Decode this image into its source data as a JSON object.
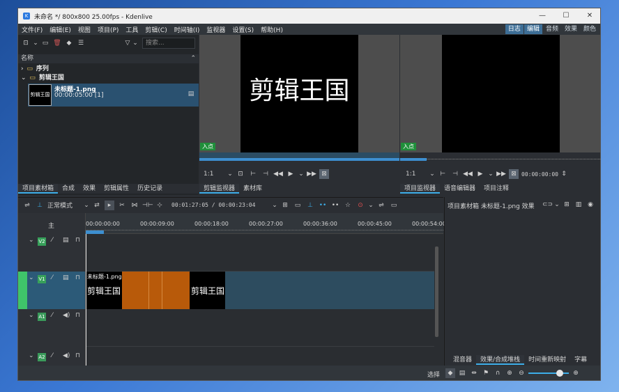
{
  "window": {
    "title": "未命名 */ 800x800 25.00fps - Kdenlive",
    "controls": [
      "—",
      "☐",
      "✕"
    ]
  },
  "menu": [
    "文件(F)",
    "编辑(E)",
    "视图",
    "项目(P)",
    "工具",
    "剪辑(C)",
    "时间轴(I)",
    "监视器",
    "设置(S)",
    "帮助(H)"
  ],
  "layouts": [
    "日志",
    "编辑",
    "音频",
    "效果",
    "颜色"
  ],
  "bin": {
    "search_placeholder": "搜索...",
    "header": "名称",
    "folders": [
      "序列",
      "剪辑王国"
    ],
    "clip": {
      "name": "未标题-1.png",
      "duration": "00:00:05:00 [1]",
      "thumb_text": "剪辑王国"
    }
  },
  "left_tabs": [
    "项目素材箱",
    "合成",
    "效果",
    "剪辑属性",
    "历史记录"
  ],
  "clip_monitor": {
    "text": "剪辑王国",
    "in_tag": "入点",
    "zoom": "1:1"
  },
  "clip_monitor_tabs": [
    "剪辑监视器",
    "素材库"
  ],
  "project_monitor": {
    "in_tag": "入点",
    "zoom": "1:1",
    "timecode": "00:00:00:00"
  },
  "project_monitor_tabs": [
    "项目监视器",
    "语音编辑器",
    "项目注释"
  ],
  "timeline_toolbar": {
    "mode": "正常模式",
    "timecode": "00:01:27:05 / 00:00:23:04"
  },
  "ruler_labels": [
    "00:00:00:00",
    "00:00:09:00",
    "00:00:18:00",
    "00:00:27:00",
    "00:00:36:00",
    "00:00:45:00",
    "00:00:54:00"
  ],
  "master_label": "主",
  "tracks": [
    {
      "name": "V2",
      "kind": "video"
    },
    {
      "name": "V1",
      "kind": "video"
    },
    {
      "name": "A1",
      "kind": "audio"
    },
    {
      "name": "A2",
      "kind": "audio"
    }
  ],
  "timeline_clip": {
    "name": "未标题-1.png",
    "text_left": "剪辑王国",
    "text_right": "剪辑王国"
  },
  "effects_panel": {
    "title": "项目素材箱 未标题-1.png 效果"
  },
  "right_tabs": [
    "混音器",
    "效果/合成堆栈",
    "时间重新映射",
    "字幕"
  ],
  "status": {
    "label": "选择"
  }
}
